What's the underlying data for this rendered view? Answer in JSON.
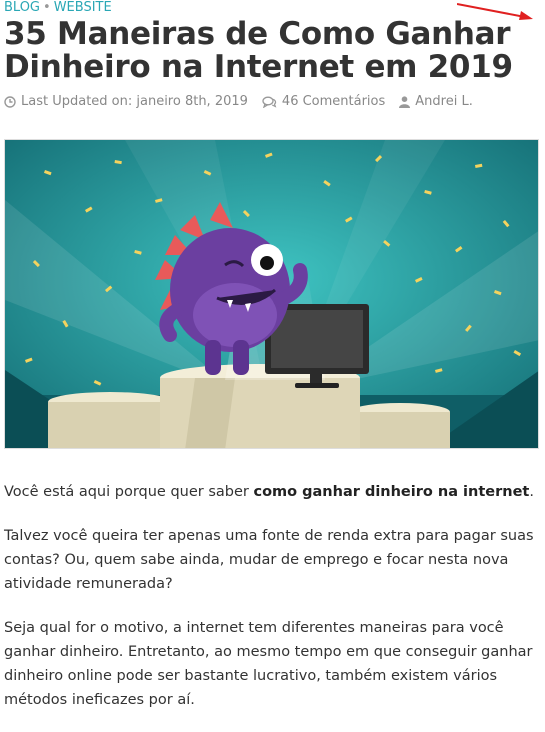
{
  "breadcrumb": {
    "category1": "BLOG",
    "separator": "•",
    "category2": "WEBSITE"
  },
  "article": {
    "title": "35 Maneiras de Como Ganhar Dinheiro na Internet em 2019",
    "meta": {
      "updated": "Last Updated on: janeiro 8th, 2019",
      "comments": "46 Comentários",
      "author": "Andrei L."
    },
    "paragraphs": {
      "p1_before": "Você está aqui porque quer saber ",
      "p1_bold": "como ganhar dinheiro na internet",
      "p1_after": ".",
      "p2": "Talvez você queira ter apenas uma fonte de renda extra para pagar suas contas? Ou, quem sabe ainda, mudar de emprego e focar nesta nova atividade remunerada?",
      "p3": "Seja qual for o motivo, a internet tem diferentes maneiras para você ganhar dinheiro. Entretanto, ao mesmo tempo em que conseguir ganhar dinheiro online pode ser bastante lucrativo, também existem vários métodos ineficazes por aí."
    }
  },
  "icons": {
    "clock": "clock-icon",
    "comments": "comments-icon",
    "user": "user-icon",
    "arrow": "red-arrow-icon"
  },
  "colors": {
    "link": "#2aa7b5",
    "text": "#333333",
    "meta": "#888888",
    "hero_bg": "#1e8e92",
    "monster": "#6b3fa0",
    "arrow": "#e02020"
  }
}
